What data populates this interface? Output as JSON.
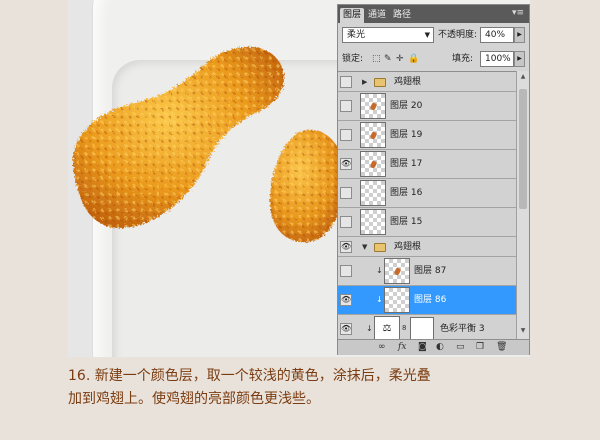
{
  "panel": {
    "tabs": [
      {
        "label": "图层",
        "active": true
      },
      {
        "label": "通道",
        "active": false
      },
      {
        "label": "路径",
        "active": false
      }
    ],
    "menu_icon": "panel-menu-icon",
    "blend_mode": "柔光",
    "opacity_label": "不透明度:",
    "opacity_value": "40%",
    "lock_label": "锁定:",
    "fill_label": "填充:",
    "fill_value": "100%",
    "layers": [
      {
        "name": "鸡翅根",
        "type": "group",
        "visible": false,
        "expanded": false
      },
      {
        "name": "图层 20",
        "type": "pixel",
        "visible": false
      },
      {
        "name": "图层 19",
        "type": "pixel",
        "visible": false
      },
      {
        "name": "图层 17",
        "type": "pixel",
        "visible": true
      },
      {
        "name": "图层 16",
        "type": "pixel",
        "visible": false
      },
      {
        "name": "图层 15",
        "type": "pixel",
        "visible": false
      },
      {
        "name": "鸡翅根",
        "type": "group",
        "visible": true,
        "expanded": true
      },
      {
        "name": "图层 87",
        "type": "pixel",
        "visible": false,
        "clipped": true
      },
      {
        "name": "图层 86",
        "type": "pixel",
        "visible": true,
        "clipped": true,
        "selected": true
      },
      {
        "name": "色彩平衡 3",
        "type": "adjustment",
        "visible": true
      }
    ],
    "bottom_icons": [
      "link-icon",
      "fx-icon",
      "mask-icon",
      "adjustment-icon",
      "folder-icon",
      "new-layer-icon",
      "trash-icon"
    ]
  },
  "caption": {
    "line1": "16. 新建一个颜色层，取一个较浅的黄色，涂抹后，柔光叠",
    "line2": "加到鸡翅上。使鸡翅的亮部颜色更浅些。"
  },
  "colors": {
    "selection": "#3399ff",
    "caption_text": "#7a3c10",
    "food_dark": "#c9650a",
    "food_light": "#f6b53a"
  }
}
